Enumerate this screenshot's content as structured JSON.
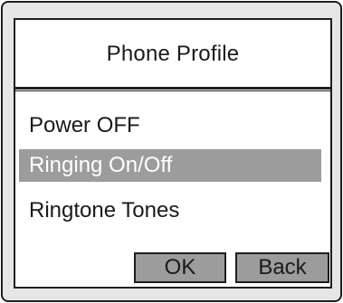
{
  "header": {
    "title": "Phone Profile"
  },
  "menu": {
    "items": [
      {
        "label": "Power OFF",
        "selected": false
      },
      {
        "label": "Ringing On/Off",
        "selected": true
      },
      {
        "label": "Ringtone Tones",
        "selected": false
      }
    ]
  },
  "softkeys": {
    "ok_label": "OK",
    "back_label": "Back"
  },
  "colors": {
    "device_background": "#e6e6e6",
    "screen_background": "#ffffff",
    "selection_highlight": "#9c9c9c",
    "softkey_background": "#9c9c9c",
    "border": "#1e1e1e"
  }
}
